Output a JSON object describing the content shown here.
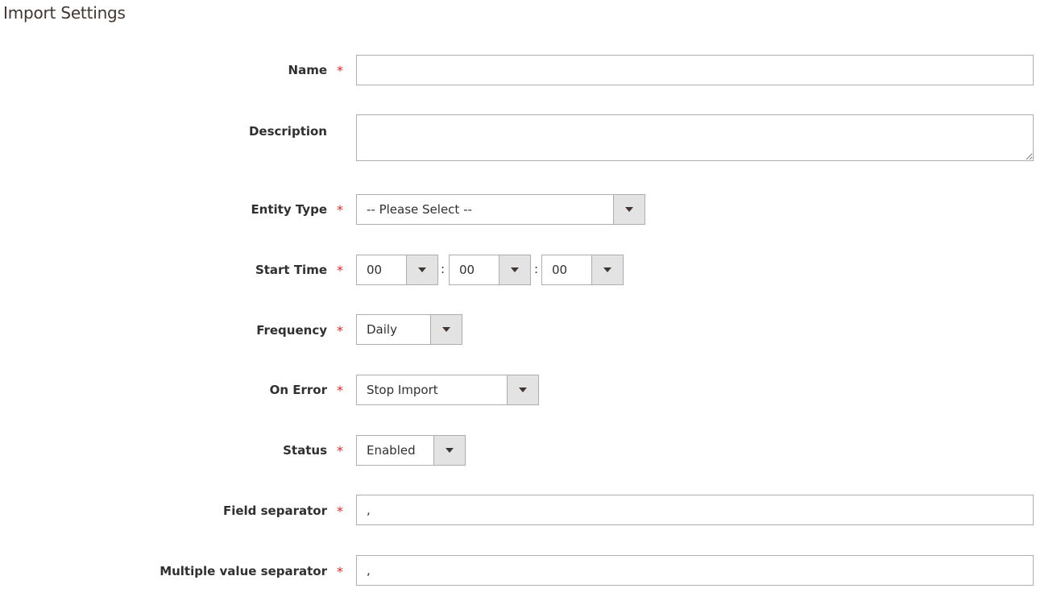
{
  "section": {
    "title": "Import Settings"
  },
  "required_marker": "*",
  "fields": {
    "name": {
      "label": "Name",
      "value": ""
    },
    "description": {
      "label": "Description",
      "value": ""
    },
    "entity_type": {
      "label": "Entity Type",
      "value": "-- Please Select --"
    },
    "start_time": {
      "label": "Start Time",
      "hour": "00",
      "minute": "00",
      "second": "00",
      "separator": ":"
    },
    "frequency": {
      "label": "Frequency",
      "value": "Daily"
    },
    "on_error": {
      "label": "On Error",
      "value": "Stop Import"
    },
    "status": {
      "label": "Status",
      "value": "Enabled"
    },
    "field_separator": {
      "label": "Field separator",
      "value": ","
    },
    "multiple_value_separator": {
      "label": "Multiple value separator",
      "value": ","
    }
  },
  "colors": {
    "required": "#e22626",
    "border": "#adadad",
    "select_arrow_bg": "#e3e3e3"
  }
}
